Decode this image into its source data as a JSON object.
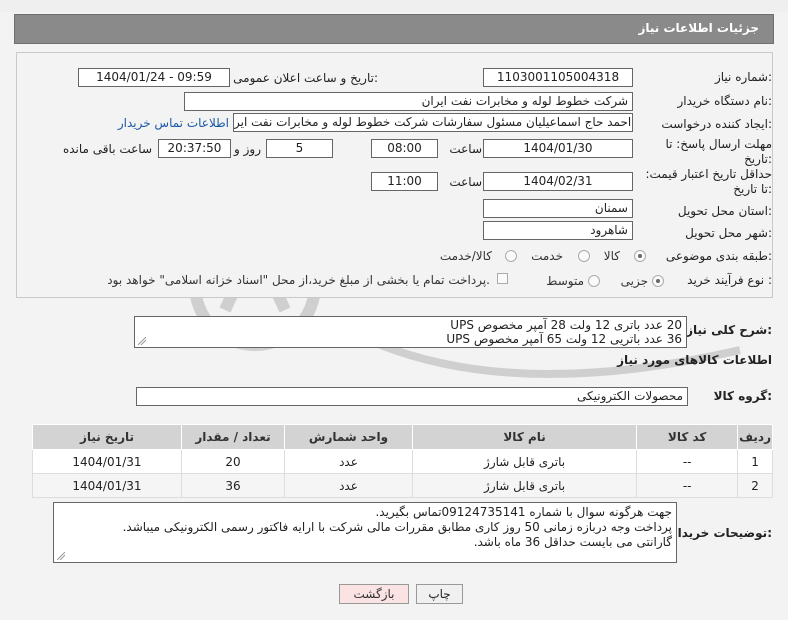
{
  "header": {
    "title": "جزئیات اطلاعات نیاز"
  },
  "fields": {
    "need_number_label": "شماره نیاز:",
    "need_number": "1103001105004318",
    "announce_label": "تاریخ و ساعت اعلان عمومی:",
    "announce_value": "1404/01/24 - 09:59",
    "buyer_label": "نام دستگاه خریدار:",
    "buyer_value": "شرکت خطوط لوله و مخابرات نفت ایران",
    "creator_label": "ایجاد کننده درخواست:",
    "creator_value": "احمد  حاج اسماعیلیان مسئول سفارشات  شرکت خطوط لوله و مخابرات نفت ایر",
    "contact_link": "اطلاعات تماس خریدار",
    "deadline_label": "مهلت ارسال پاسخ: تا تاریخ:",
    "deadline_date": "1404/01/30",
    "time_label": "ساعت",
    "deadline_time": "08:00",
    "days_value": "5",
    "days_label": "روز و",
    "remaining_time": "20:37:50",
    "remaining_label": "ساعت باقی مانده",
    "validity_label": "حداقل تاریخ اعتبار قیمت: تا تاریخ:",
    "validity_date": "1404/02/31",
    "validity_time": "11:00",
    "province_label": "استان محل تحویل:",
    "province_value": "سمنان",
    "city_label": "شهر محل تحویل:",
    "city_value": "شاهرود",
    "category_label": "طبقه بندی موضوعی:",
    "category_options": [
      "کالا",
      "خدمت",
      "کالا/خدمت"
    ],
    "process_label": "نوع فرآیند خرید :",
    "process_options": [
      "جزیی",
      "متوسط"
    ],
    "payment_note": "پرداخت تمام یا بخشی از مبلغ خرید،از محل \"اسناد خزانه اسلامی\" خواهد بود."
  },
  "description": {
    "label": "شرح کلی نیاز:",
    "line1": "20 عدد باتری 12 ولت 28 آمپر مخصوص UPS",
    "line2": "36 عدد باتریی 12 ولت 65 آمپر مخصوص UPS"
  },
  "goods_section": {
    "title": "اطلاعات کالاهای مورد نیاز",
    "group_label": "گروه کالا:",
    "group_value": "محصولات الکترونیکی"
  },
  "table": {
    "headers": [
      "ردیف",
      "کد کالا",
      "نام کالا",
      "واحد شمارش",
      "تعداد / مقدار",
      "تاریخ نیاز"
    ],
    "rows": [
      [
        "1",
        "--",
        "باتری قابل شارژ",
        "عدد",
        "20",
        "1404/01/31"
      ],
      [
        "2",
        "--",
        "باتری قابل شارژ",
        "عدد",
        "36",
        "1404/01/31"
      ]
    ]
  },
  "buyer_notes": {
    "label": "توضیحات خریدار:",
    "line1": "جهت هرگونه سوال با شماره 09124735141تماس بگیرید.",
    "line2": "پرداخت وجه دربازه زمانی 50 روز کاری مطابق مقررات مالی شرکت با ارایه فاکتور رسمی الکترونیکی میباشد.",
    "line3": "گارانتی می بایست حداقل 36 ماه باشد."
  },
  "buttons": {
    "print": "چاپ",
    "back": "بازگشت"
  },
  "colors": {
    "header_bg": "#8a8a8a",
    "link": "#1a5aa6",
    "back_btn_bg": "#fbe3e3"
  }
}
